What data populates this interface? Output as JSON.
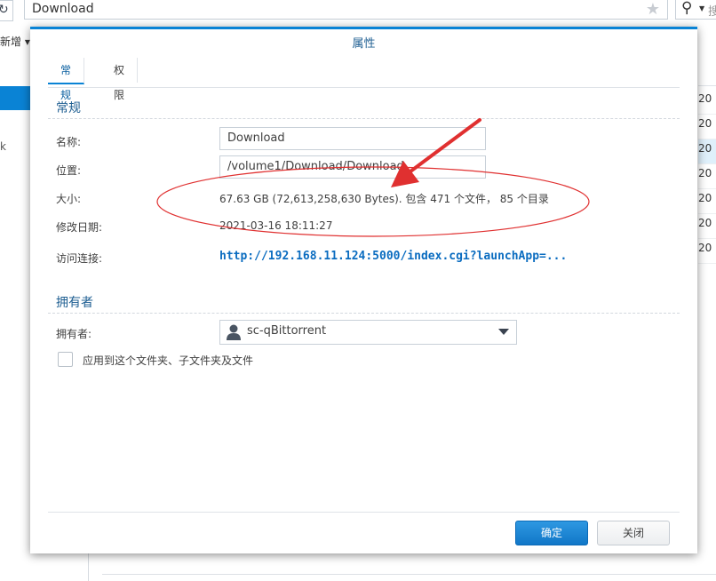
{
  "background": {
    "refresh_icon": "refresh-icon",
    "path_value": "Download",
    "search_placeholder": "搜",
    "toolbar_new_label": "新增",
    "sidebar_x": "k",
    "date_column": [
      "20",
      "20",
      "20",
      "20",
      "20",
      "20",
      "20"
    ]
  },
  "dialog": {
    "title": "属性",
    "tabs": [
      {
        "label": "常规",
        "active": true
      },
      {
        "label": "权限",
        "active": false
      }
    ],
    "general": {
      "section_title": "常规",
      "name_label": "名称:",
      "name_value": "Download",
      "location_label": "位置:",
      "location_value": "/volume1/Download/Download",
      "size_label": "大小:",
      "size_value": "67.63 GB (72,613,258,630 Bytes). 包含 471 个文件， 85 个目录",
      "modified_label": "修改日期:",
      "modified_value": "2021-03-16 18:11:27",
      "link_label": "访问连接:",
      "link_value": "http://192.168.11.124:5000/index.cgi?launchApp=..."
    },
    "owner": {
      "section_title": "拥有者",
      "owner_label": "拥有者:",
      "owner_value": "sc-qBittorrent",
      "apply_checkbox_label": "应用到这个文件夹、子文件夹及文件",
      "apply_checked": false
    },
    "buttons": {
      "ok": "确定",
      "close": "关闭"
    }
  },
  "colors": {
    "accent": "#0a83d5",
    "annotation": "#e03030"
  }
}
